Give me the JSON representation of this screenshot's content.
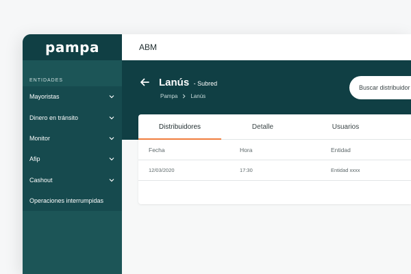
{
  "sidebar": {
    "logo": "pampa",
    "section_title": "ENTIDADES",
    "items": [
      {
        "label": "Mayoristas"
      },
      {
        "label": "Dinero en tránsito"
      },
      {
        "label": "Monitor"
      },
      {
        "label": "Afip"
      },
      {
        "label": "Cashout"
      },
      {
        "label": "Operaciones interrumpidas"
      }
    ]
  },
  "topbar": {
    "title": "ABM"
  },
  "header": {
    "title": "Lanús",
    "subtitle": "- Subred",
    "breadcrumb": [
      "Pampa",
      "Lanús"
    ],
    "search_placeholder": "Buscar distribuidor"
  },
  "tabs": [
    {
      "label": "Distribuidores",
      "active": true
    },
    {
      "label": "Detalle",
      "active": false
    },
    {
      "label": "Usuarios",
      "active": false
    }
  ],
  "table": {
    "columns": [
      "Fecha",
      "Hora",
      "Entidad"
    ],
    "rows": [
      [
        "12/03/2020",
        "17:30",
        "Entidad xxxx"
      ]
    ]
  },
  "colors": {
    "sidebar": "#1c5557",
    "header": "#103f44",
    "accent": "#f07b3b"
  }
}
